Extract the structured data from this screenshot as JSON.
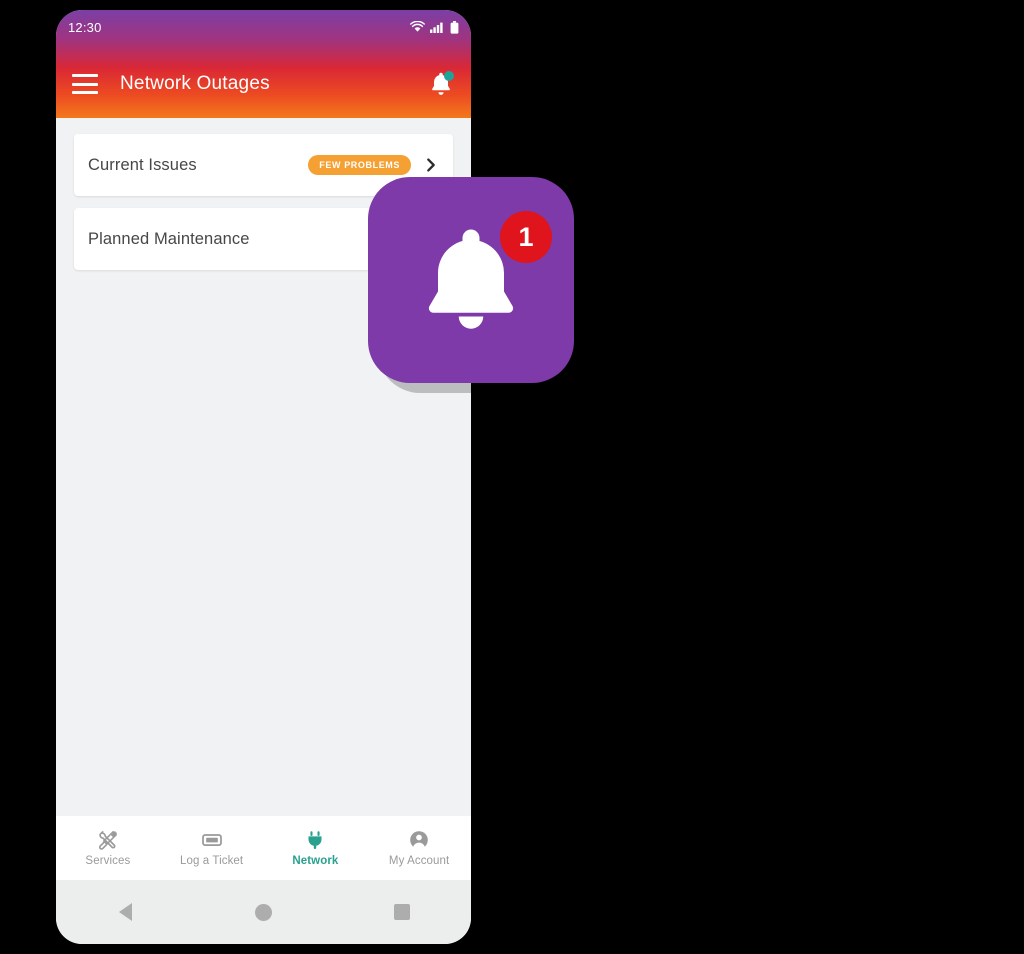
{
  "colors": {
    "header_gradient_start": "#7b3fa5",
    "header_gradient_mid": "#da2835",
    "header_gradient_end": "#f3781c",
    "accent_teal": "#2aa18f",
    "badge_orange": "#f5a032",
    "badge_teal": "#37a8a0",
    "notification_tile_purple": "#7d3aa8",
    "notification_count_red": "#e0141c",
    "screen_background": "#f1f2f4",
    "card_background": "#ffffff",
    "page_background": "#000000"
  },
  "status_bar": {
    "time": "12:30",
    "icons": [
      "wifi-icon",
      "cellular-signal-icon",
      "battery-icon"
    ]
  },
  "app_bar": {
    "menu_icon": "hamburger-menu-icon",
    "title": "Network Outages",
    "bell_icon": "notification-bell-icon",
    "bell_has_badge": true
  },
  "main": {
    "cards": [
      {
        "label": "Current Issues",
        "badge": "FEW PROBLEMS",
        "badge_style": "orange",
        "chevron": "chevron-right-icon"
      },
      {
        "label": "Planned Maintenance",
        "badge": "",
        "badge_style": "teal",
        "chevron": "chevron-right-icon"
      }
    ]
  },
  "bottom_nav": {
    "items": [
      {
        "label": "Services",
        "icon": "tools-icon",
        "active": false
      },
      {
        "label": "Log a Ticket",
        "icon": "ticket-icon",
        "active": false
      },
      {
        "label": "Network",
        "icon": "plug-icon",
        "active": true
      },
      {
        "label": "My Account",
        "icon": "person-icon",
        "active": false
      }
    ]
  },
  "system_nav": {
    "back": "back-triangle-icon",
    "home": "home-circle-icon",
    "recents": "recents-square-icon"
  },
  "notification_overlay": {
    "icon": "bell-icon",
    "count": "1"
  }
}
